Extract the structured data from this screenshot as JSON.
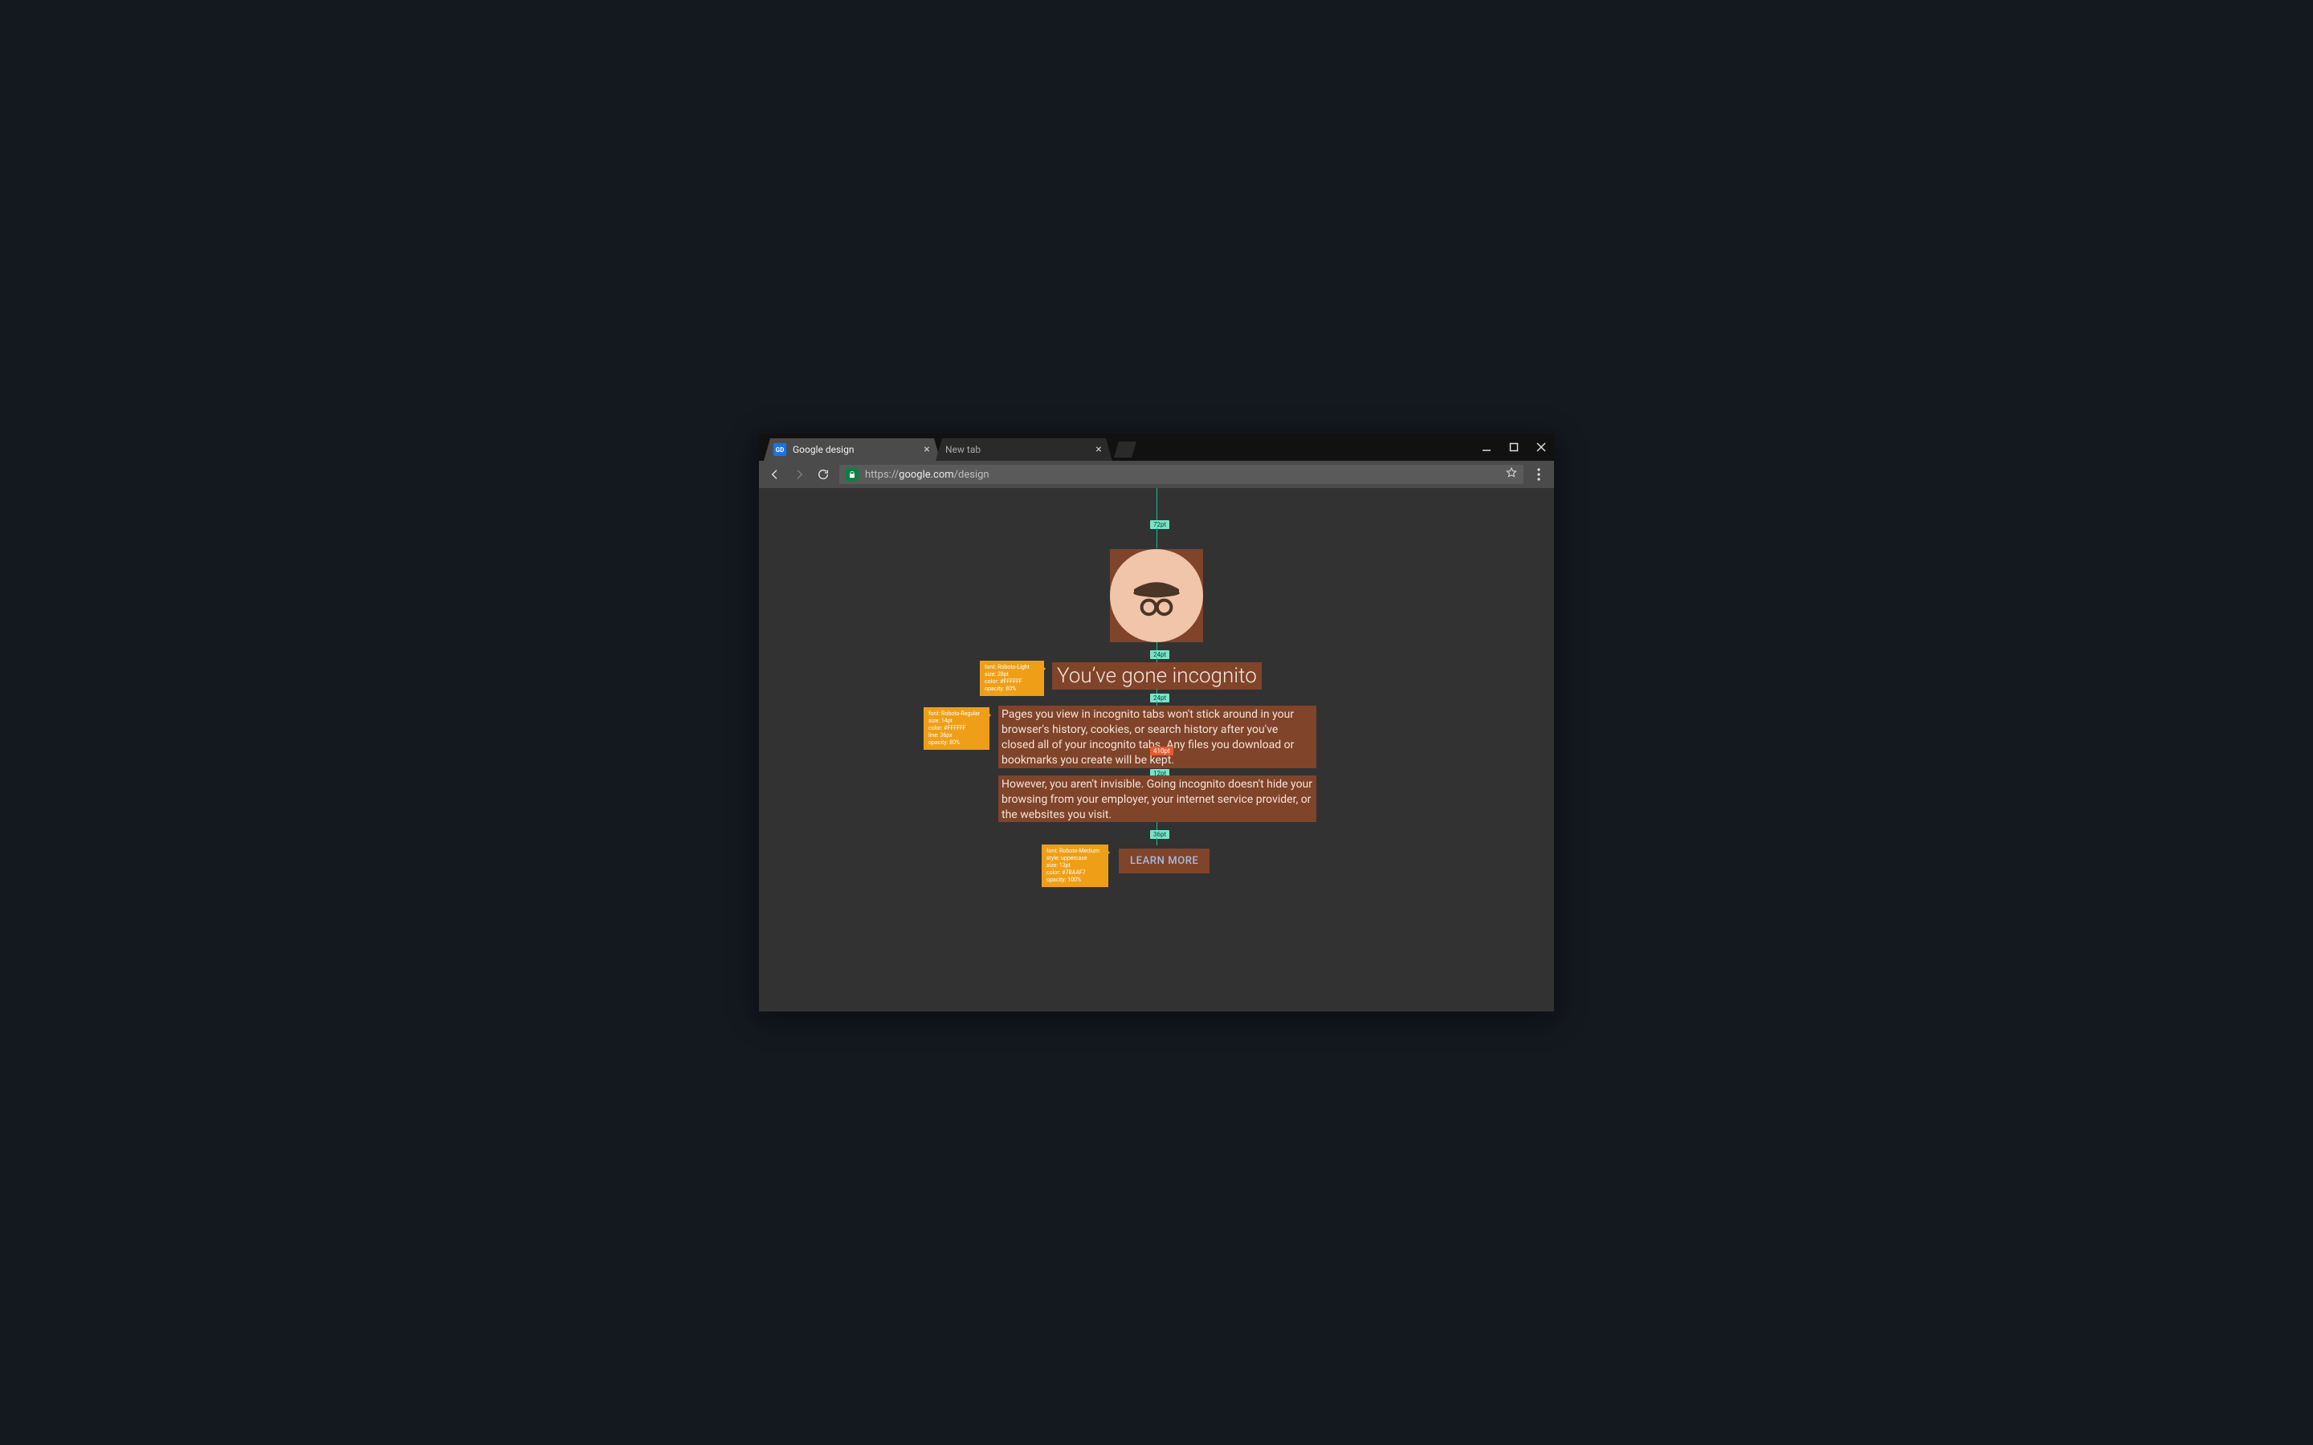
{
  "tabs": [
    {
      "title": "Google design",
      "favicon": "GD",
      "active": true
    },
    {
      "title": "New tab",
      "favicon": "",
      "active": false
    }
  ],
  "window_controls": {
    "min": "–",
    "max": "▢",
    "close": "✕"
  },
  "toolbar": {
    "url_scheme": "https://",
    "url_host": "google.com",
    "url_path": "/design"
  },
  "spacing_chips": {
    "s1": "72pt",
    "s2": "24pt",
    "s3": "24pt",
    "s4": "12pt",
    "s5": "36pt"
  },
  "width_chip": "410pt",
  "specs": {
    "heading": {
      "font": "font: Roboto-Light",
      "size": "size: 28pt",
      "color": "color: #FFFFFF",
      "opacity": "opacity: 80%"
    },
    "body": {
      "font": "font: Roboto-Regular",
      "size": "size: 14pt",
      "color": "color: #FFFFFF",
      "line": "line: 36px",
      "opacity": "opacity: 80%"
    },
    "button": {
      "font": "font: Roboto-Medium",
      "style": "style: uppercase",
      "size": "size: 13pt",
      "color": "color: #7BAAF7",
      "opacity": "opacity: 100%"
    }
  },
  "content": {
    "heading": "You’ve gone incognito",
    "para1": "Pages you view in incognito tabs won't stick around in your browser's history, cookies, or search history after you've closed all of your incognito tabs. Any files you download or bookmarks you create will be kept.",
    "para2": "However, you aren't invisible. Going incognito doesn't hide your browsing from your employer, your internet service provider, or the websites you visit.",
    "learn_more": "Learn More"
  }
}
